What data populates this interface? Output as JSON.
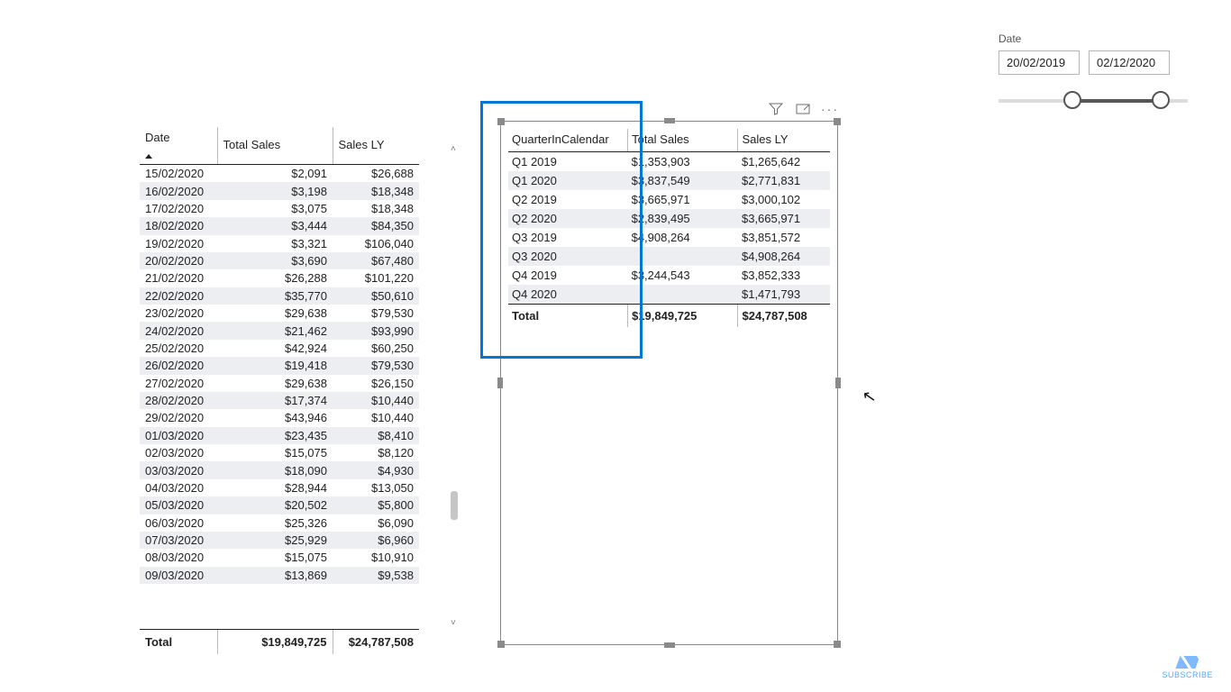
{
  "leftTable": {
    "headers": {
      "date": "Date",
      "sales": "Total Sales",
      "ly": "Sales LY"
    },
    "rows": [
      {
        "date": "15/02/2020",
        "sales": "$2,091",
        "ly": "$26,688"
      },
      {
        "date": "16/02/2020",
        "sales": "$3,198",
        "ly": "$18,348"
      },
      {
        "date": "17/02/2020",
        "sales": "$3,075",
        "ly": "$18,348"
      },
      {
        "date": "18/02/2020",
        "sales": "$3,444",
        "ly": "$84,350"
      },
      {
        "date": "19/02/2020",
        "sales": "$3,321",
        "ly": "$106,040"
      },
      {
        "date": "20/02/2020",
        "sales": "$3,690",
        "ly": "$67,480"
      },
      {
        "date": "21/02/2020",
        "sales": "$26,288",
        "ly": "$101,220"
      },
      {
        "date": "22/02/2020",
        "sales": "$35,770",
        "ly": "$50,610"
      },
      {
        "date": "23/02/2020",
        "sales": "$29,638",
        "ly": "$79,530"
      },
      {
        "date": "24/02/2020",
        "sales": "$21,462",
        "ly": "$93,990"
      },
      {
        "date": "25/02/2020",
        "sales": "$42,924",
        "ly": "$60,250"
      },
      {
        "date": "26/02/2020",
        "sales": "$19,418",
        "ly": "$79,530"
      },
      {
        "date": "27/02/2020",
        "sales": "$29,638",
        "ly": "$26,150"
      },
      {
        "date": "28/02/2020",
        "sales": "$17,374",
        "ly": "$10,440"
      },
      {
        "date": "29/02/2020",
        "sales": "$43,946",
        "ly": "$10,440"
      },
      {
        "date": "01/03/2020",
        "sales": "$23,435",
        "ly": "$8,410"
      },
      {
        "date": "02/03/2020",
        "sales": "$15,075",
        "ly": "$8,120"
      },
      {
        "date": "03/03/2020",
        "sales": "$18,090",
        "ly": "$4,930"
      },
      {
        "date": "04/03/2020",
        "sales": "$28,944",
        "ly": "$13,050"
      },
      {
        "date": "05/03/2020",
        "sales": "$20,502",
        "ly": "$5,800"
      },
      {
        "date": "06/03/2020",
        "sales": "$25,326",
        "ly": "$6,090"
      },
      {
        "date": "07/03/2020",
        "sales": "$25,929",
        "ly": "$6,960"
      },
      {
        "date": "08/03/2020",
        "sales": "$15,075",
        "ly": "$10,910"
      },
      {
        "date": "09/03/2020",
        "sales": "$13,869",
        "ly": "$9,538"
      }
    ],
    "totalLabel": "Total",
    "totals": {
      "sales": "$19,849,725",
      "ly": "$24,787,508"
    }
  },
  "rightTable": {
    "headers": {
      "quarter": "QuarterInCalendar",
      "sales": "Total Sales",
      "ly": "Sales LY"
    },
    "rows": [
      {
        "q": "Q1 2019",
        "sales": "$1,353,903",
        "ly": "$1,265,642"
      },
      {
        "q": "Q1 2020",
        "sales": "$3,837,549",
        "ly": "$2,771,831"
      },
      {
        "q": "Q2 2019",
        "sales": "$3,665,971",
        "ly": "$3,000,102"
      },
      {
        "q": "Q2 2020",
        "sales": "$2,839,495",
        "ly": "$3,665,971"
      },
      {
        "q": "Q3 2019",
        "sales": "$4,908,264",
        "ly": "$3,851,572"
      },
      {
        "q": "Q3 2020",
        "sales": "",
        "ly": "$4,908,264"
      },
      {
        "q": "Q4 2019",
        "sales": "$3,244,543",
        "ly": "$3,852,333"
      },
      {
        "q": "Q4 2020",
        "sales": "",
        "ly": "$1,471,793"
      }
    ],
    "totalLabel": "Total",
    "totals": {
      "sales": "$19,849,725",
      "ly": "$24,787,508"
    }
  },
  "slicer": {
    "label": "Date",
    "from": "20/02/2019",
    "to": "02/12/2020"
  },
  "misc": {
    "subscribe": "SUBSCRIBE",
    "ellipsis": "···"
  }
}
